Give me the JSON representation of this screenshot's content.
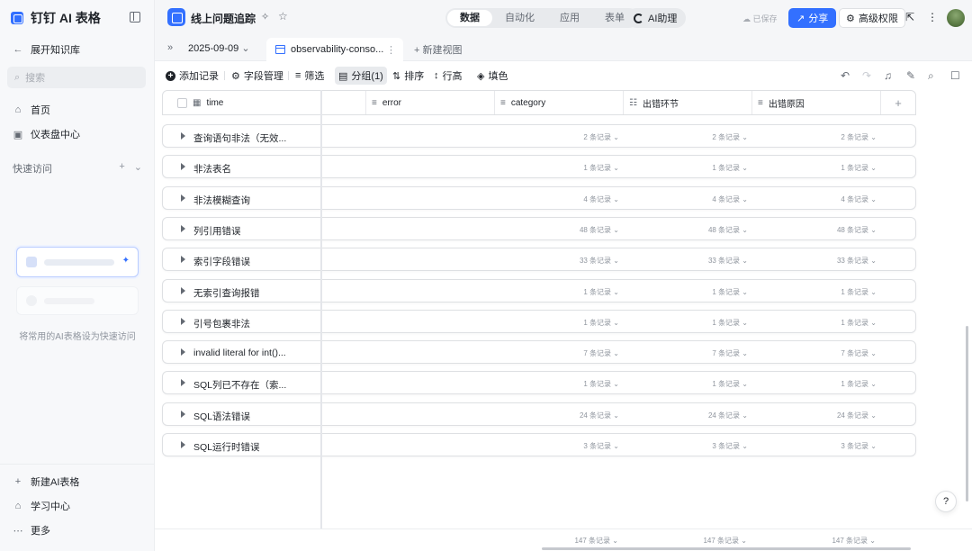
{
  "sidebar": {
    "brand": "钉钉 AI 表格",
    "expand_kb": "展开知识库",
    "search_placeholder": "搜索",
    "nav": [
      {
        "label": "首页",
        "icon": "home-icon"
      },
      {
        "label": "仪表盘中心",
        "icon": "dashboard-icon"
      }
    ],
    "quick_access_title": "快速访问",
    "quick_access_hint": "将常用的AI表格设为快速访问",
    "bottom": [
      {
        "label": "新建AI表格",
        "icon": "plus-icon"
      },
      {
        "label": "学习中心",
        "icon": "graduation-icon"
      },
      {
        "label": "更多",
        "icon": "more-icon"
      }
    ]
  },
  "topbar": {
    "doc_title": "线上问题追踪",
    "tabs": [
      "数据",
      "自动化",
      "应用",
      "表单"
    ],
    "active_tab": "数据",
    "ai_assistant": "AI助理",
    "saved_status": "已保存",
    "share": "分享",
    "advanced_permission": "高级权限"
  },
  "tabrow": {
    "date_view": "2025-09-09",
    "active_view": "observability-conso...",
    "new_view": "新建视图"
  },
  "toolbar": {
    "add_record": "添加记录",
    "field_manage": "字段管理",
    "filter": "筛选",
    "group": "分组(1)",
    "sort": "排序",
    "row_height": "行高",
    "fill_color": "填色"
  },
  "columns": [
    "time",
    "error",
    "category",
    "出错环节",
    "出错原因"
  ],
  "groups": [
    {
      "name": "查询语句非法（无效...",
      "count": "2 条记录"
    },
    {
      "name": "非法表名",
      "count": "1 条记录"
    },
    {
      "name": "非法模糊查询",
      "count": "4 条记录"
    },
    {
      "name": "列引用错误",
      "count": "48 条记录"
    },
    {
      "name": "索引字段错误",
      "count": "33 条记录"
    },
    {
      "name": "无索引查询报错",
      "count": "1 条记录"
    },
    {
      "name": "引号包裹非法",
      "count": "1 条记录"
    },
    {
      "name": "invalid literal for int()...",
      "count": "7 条记录"
    },
    {
      "name": "SQL列已不存在（索...",
      "count": "1 条记录"
    },
    {
      "name": "SQL语法错误",
      "count": "24 条记录"
    },
    {
      "name": "SQL运行时错误",
      "count": "3 条记录"
    }
  ],
  "footer_count": "147 条记录",
  "help": "?"
}
